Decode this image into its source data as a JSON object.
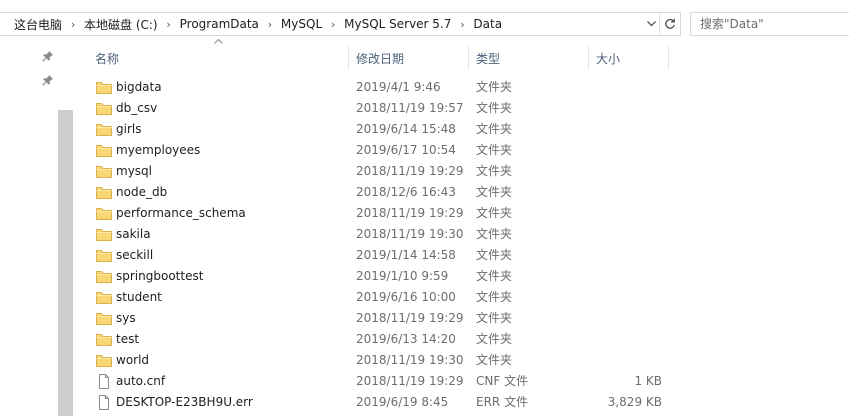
{
  "breadcrumb": [
    "这台电脑",
    "本地磁盘 (C:)",
    "ProgramData",
    "MySQL",
    "MySQL Server 5.7",
    "Data"
  ],
  "search": {
    "placeholder": "搜索\"Data\""
  },
  "columns": {
    "name": "名称",
    "date": "修改日期",
    "type": "类型",
    "size": "大小"
  },
  "files": [
    {
      "name": "bigdata",
      "date": "2019/4/1 9:46",
      "type": "文件夹",
      "size": "",
      "icon": "folder-icon"
    },
    {
      "name": "db_csv",
      "date": "2018/11/19 19:57",
      "type": "文件夹",
      "size": "",
      "icon": "folder-icon"
    },
    {
      "name": "girls",
      "date": "2019/6/14 15:48",
      "type": "文件夹",
      "size": "",
      "icon": "folder-icon"
    },
    {
      "name": "myemployees",
      "date": "2019/6/17 10:54",
      "type": "文件夹",
      "size": "",
      "icon": "folder-icon"
    },
    {
      "name": "mysql",
      "date": "2018/11/19 19:29",
      "type": "文件夹",
      "size": "",
      "icon": "folder-icon"
    },
    {
      "name": "node_db",
      "date": "2018/12/6 16:43",
      "type": "文件夹",
      "size": "",
      "icon": "folder-icon"
    },
    {
      "name": "performance_schema",
      "date": "2018/11/19 19:29",
      "type": "文件夹",
      "size": "",
      "icon": "folder-icon"
    },
    {
      "name": "sakila",
      "date": "2018/11/19 19:30",
      "type": "文件夹",
      "size": "",
      "icon": "folder-icon"
    },
    {
      "name": "seckill",
      "date": "2019/1/14 14:58",
      "type": "文件夹",
      "size": "",
      "icon": "folder-icon"
    },
    {
      "name": "springboottest",
      "date": "2019/1/10 9:59",
      "type": "文件夹",
      "size": "",
      "icon": "folder-icon"
    },
    {
      "name": "student",
      "date": "2019/6/16 10:00",
      "type": "文件夹",
      "size": "",
      "icon": "folder-icon"
    },
    {
      "name": "sys",
      "date": "2018/11/19 19:29",
      "type": "文件夹",
      "size": "",
      "icon": "folder-icon"
    },
    {
      "name": "test",
      "date": "2019/6/13 14:20",
      "type": "文件夹",
      "size": "",
      "icon": "folder-icon"
    },
    {
      "name": "world",
      "date": "2018/11/19 19:30",
      "type": "文件夹",
      "size": "",
      "icon": "folder-icon"
    },
    {
      "name": "auto.cnf",
      "date": "2018/11/19 19:29",
      "type": "CNF 文件",
      "size": "1 KB",
      "icon": "file-icon"
    },
    {
      "name": "DESKTOP-E23BH9U.err",
      "date": "2019/6/19 8:45",
      "type": "ERR 文件",
      "size": "3,829 KB",
      "icon": "file-icon"
    }
  ],
  "colors": {
    "folder": "#f8d775",
    "header_text": "#4c607a",
    "secondary_text": "#6d6d6d"
  }
}
